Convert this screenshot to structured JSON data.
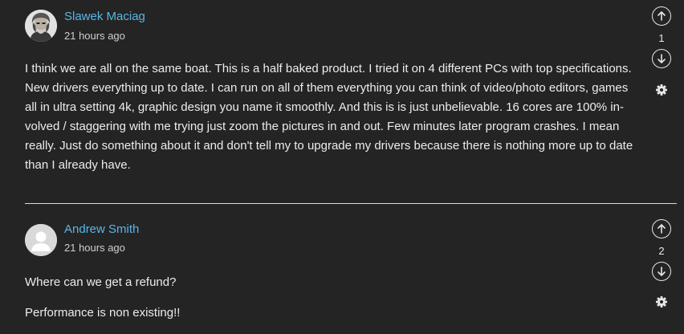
{
  "comments": [
    {
      "author": "Slawek Maciag",
      "time": "21 hours ago",
      "votes": "1",
      "avatar_icon": "user-photo-avatar",
      "paragraphs": [
        "I think we are all on the same boat. This is a half baked product. I tried it on 4 different PCs with top specifications. New drivers everything up to date. I can run on all of them everything you can think of video/photo editors, games all in ultra setting 4k, graphic design you name it smoothly. And this is is just unbelievable. 16 cores are 100% in-volved / staggering with me trying just zoom the pictures in and out. Few minutes later program crashes. I mean really. Just do something about it and don't tell my to upgrade my drivers because there is nothing more up to date than I already have."
      ]
    },
    {
      "author": "Andrew Smith",
      "time": "21 hours ago",
      "votes": "2",
      "avatar_icon": "default-user-avatar",
      "paragraphs": [
        "Where can we get a refund?",
        "Performance is non existing!!"
      ]
    }
  ],
  "colors": {
    "background": "#242424",
    "author_link": "#59b6e6",
    "text": "#ececec"
  }
}
